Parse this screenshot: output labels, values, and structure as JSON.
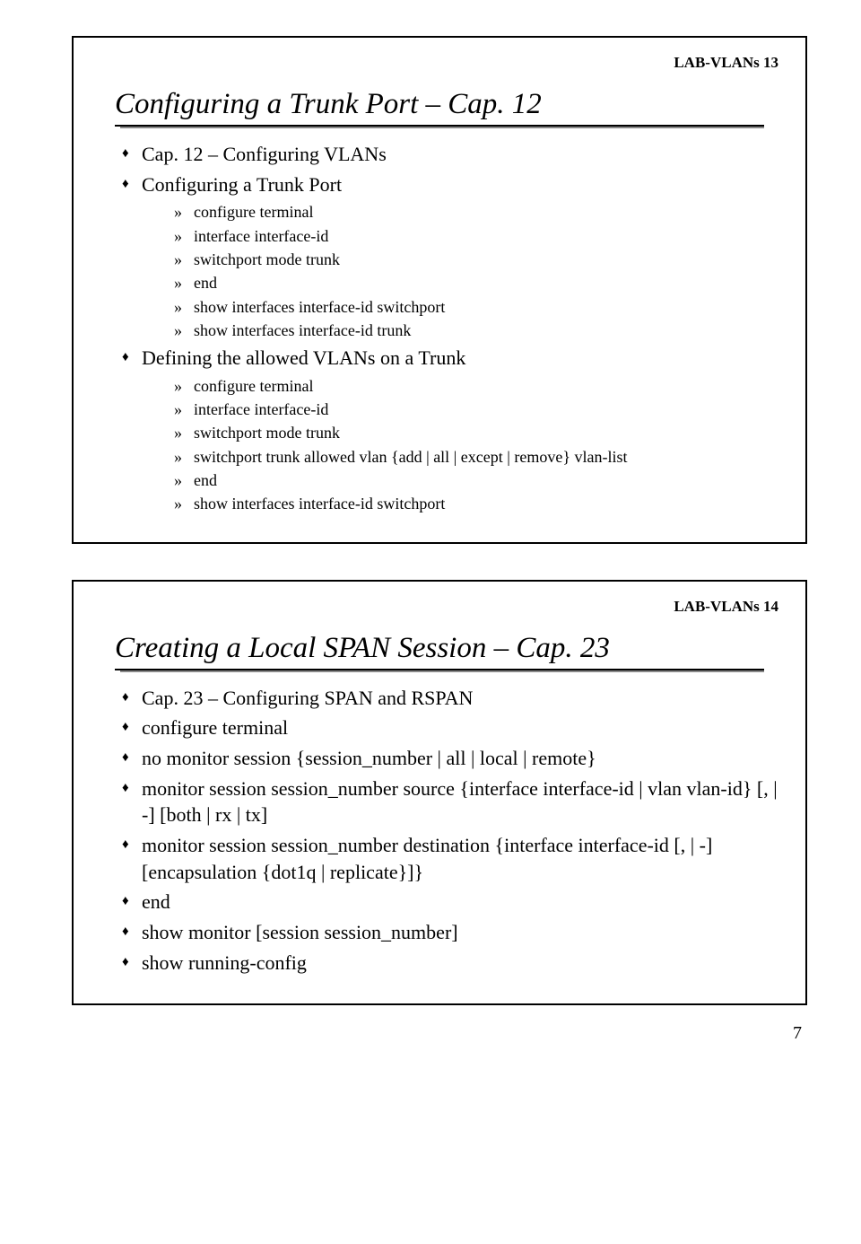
{
  "page_number": "7",
  "slide1": {
    "code": "LAB-VLANs 13",
    "title": "Configuring a Trunk Port – Cap. 12",
    "items": [
      {
        "text": "Cap. 12 – Configuring VLANs"
      },
      {
        "text": "Configuring a Trunk Port",
        "sub": [
          "configure terminal",
          "interface interface-id",
          "switchport mode trunk",
          "end",
          "show interfaces interface-id switchport",
          "show interfaces interface-id trunk"
        ]
      },
      {
        "text": "Defining the allowed VLANs on a Trunk",
        "sub": [
          "configure terminal",
          "interface interface-id",
          "switchport mode trunk",
          "switchport trunk allowed vlan {add | all | except | remove} vlan-list",
          "end",
          "show interfaces interface-id switchport"
        ]
      }
    ]
  },
  "slide2": {
    "code": "LAB-VLANs 14",
    "title": "Creating a Local SPAN Session – Cap. 23",
    "items": [
      {
        "text": "Cap. 23 – Configuring SPAN and RSPAN"
      },
      {
        "text": "configure terminal"
      },
      {
        "text": "no monitor session {session_number | all | local | remote}"
      },
      {
        "text": "monitor session session_number source {interface interface-id | vlan vlan-id} [, | -] [both | rx | tx]"
      },
      {
        "text": "monitor session session_number destination {interface interface-id [, | -] [encapsulation {dot1q | replicate}]}"
      },
      {
        "text": "end"
      },
      {
        "text": "show monitor [session session_number]"
      },
      {
        "text": "show running-config"
      }
    ]
  }
}
